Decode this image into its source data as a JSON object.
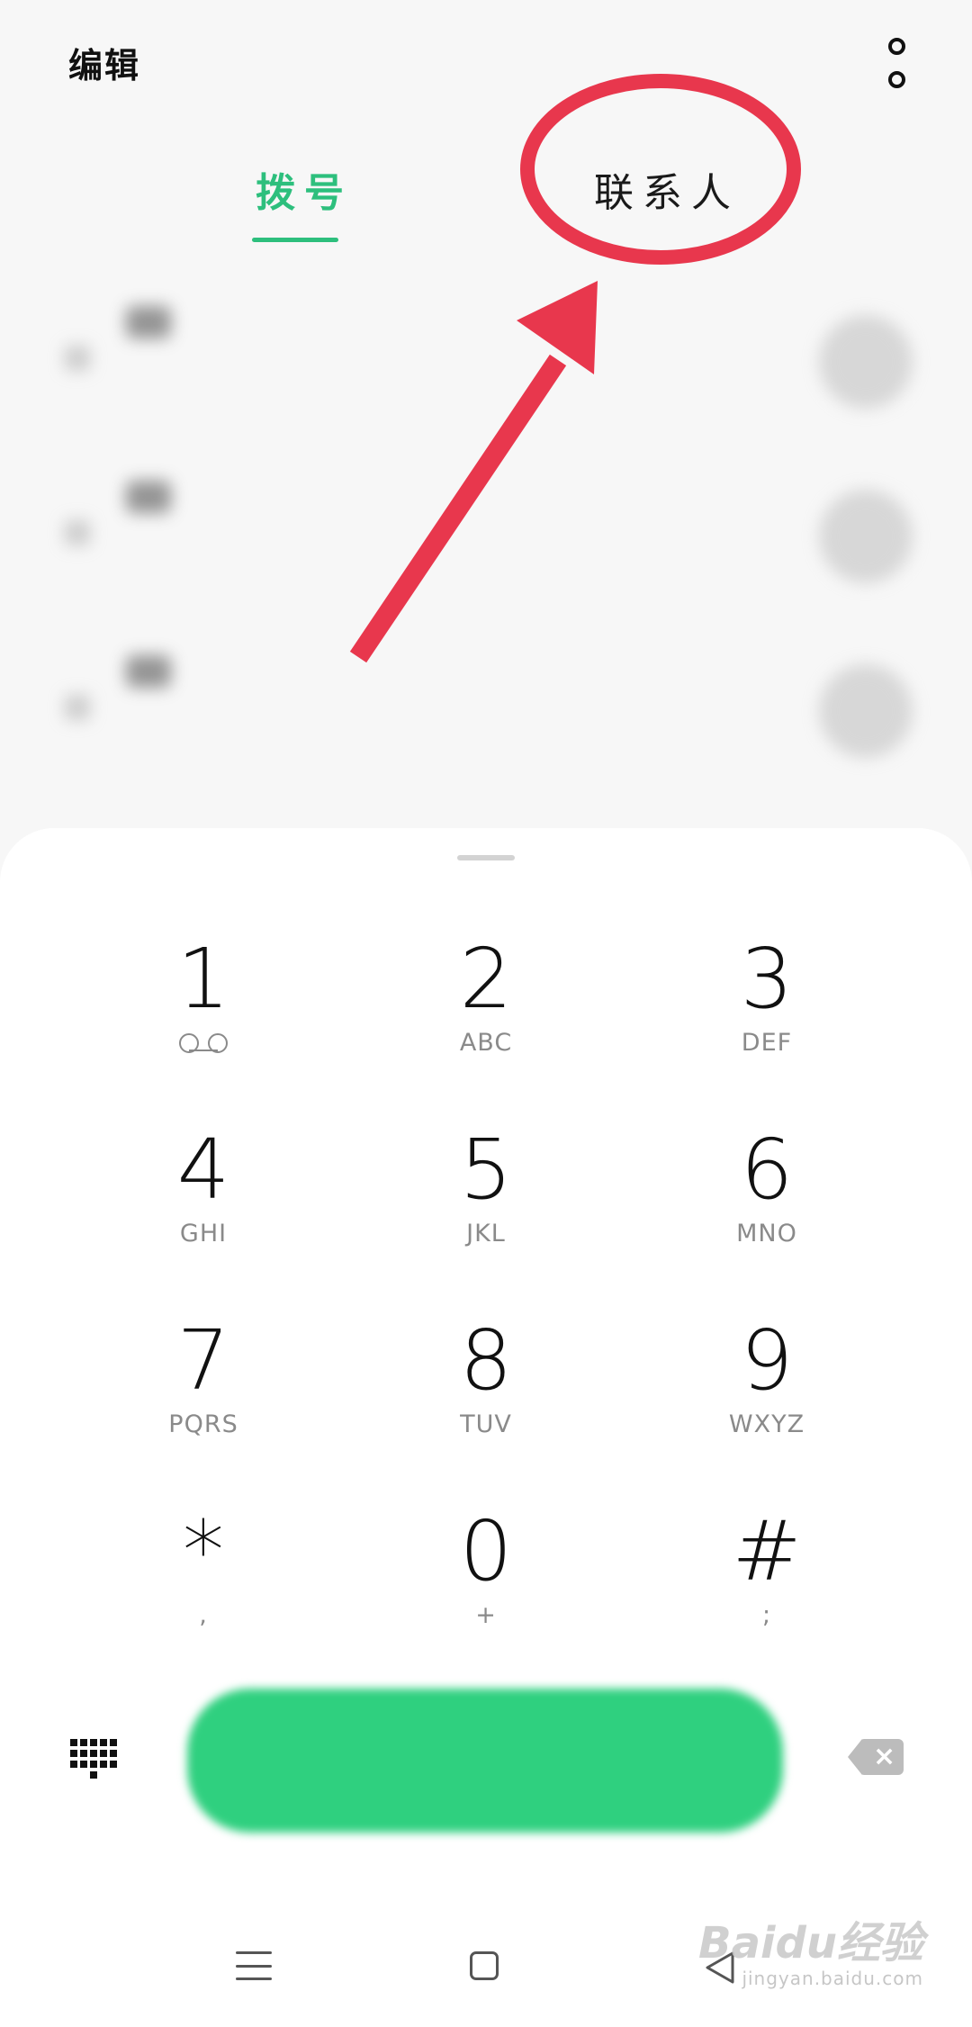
{
  "header": {
    "edit_label": "编辑",
    "more_icon": "more-vertical-icon"
  },
  "tabs": [
    {
      "label": "拨号",
      "active": true
    },
    {
      "label": "联系人",
      "active": false
    }
  ],
  "colors": {
    "accent": "#2dbf7d",
    "call_button": "#2fd07f",
    "annotation_red": "#e8374d"
  },
  "dialpad": {
    "keys": [
      {
        "digit": "1",
        "letters": "",
        "icon": "voicemail-icon"
      },
      {
        "digit": "2",
        "letters": "ABC"
      },
      {
        "digit": "3",
        "letters": "DEF"
      },
      {
        "digit": "4",
        "letters": "GHI"
      },
      {
        "digit": "5",
        "letters": "JKL"
      },
      {
        "digit": "6",
        "letters": "MNO"
      },
      {
        "digit": "7",
        "letters": "PQRS"
      },
      {
        "digit": "8",
        "letters": "TUV"
      },
      {
        "digit": "9",
        "letters": "WXYZ"
      },
      {
        "digit": "*",
        "letters": ","
      },
      {
        "digit": "0",
        "letters": "+"
      },
      {
        "digit": "#",
        "letters": ";"
      }
    ]
  },
  "controls": {
    "keypad_toggle_icon": "dialpad-grid-icon",
    "backspace_icon": "backspace-icon"
  },
  "watermark": {
    "main": "Baidu经验",
    "sub": "jingyan.baidu.com"
  }
}
